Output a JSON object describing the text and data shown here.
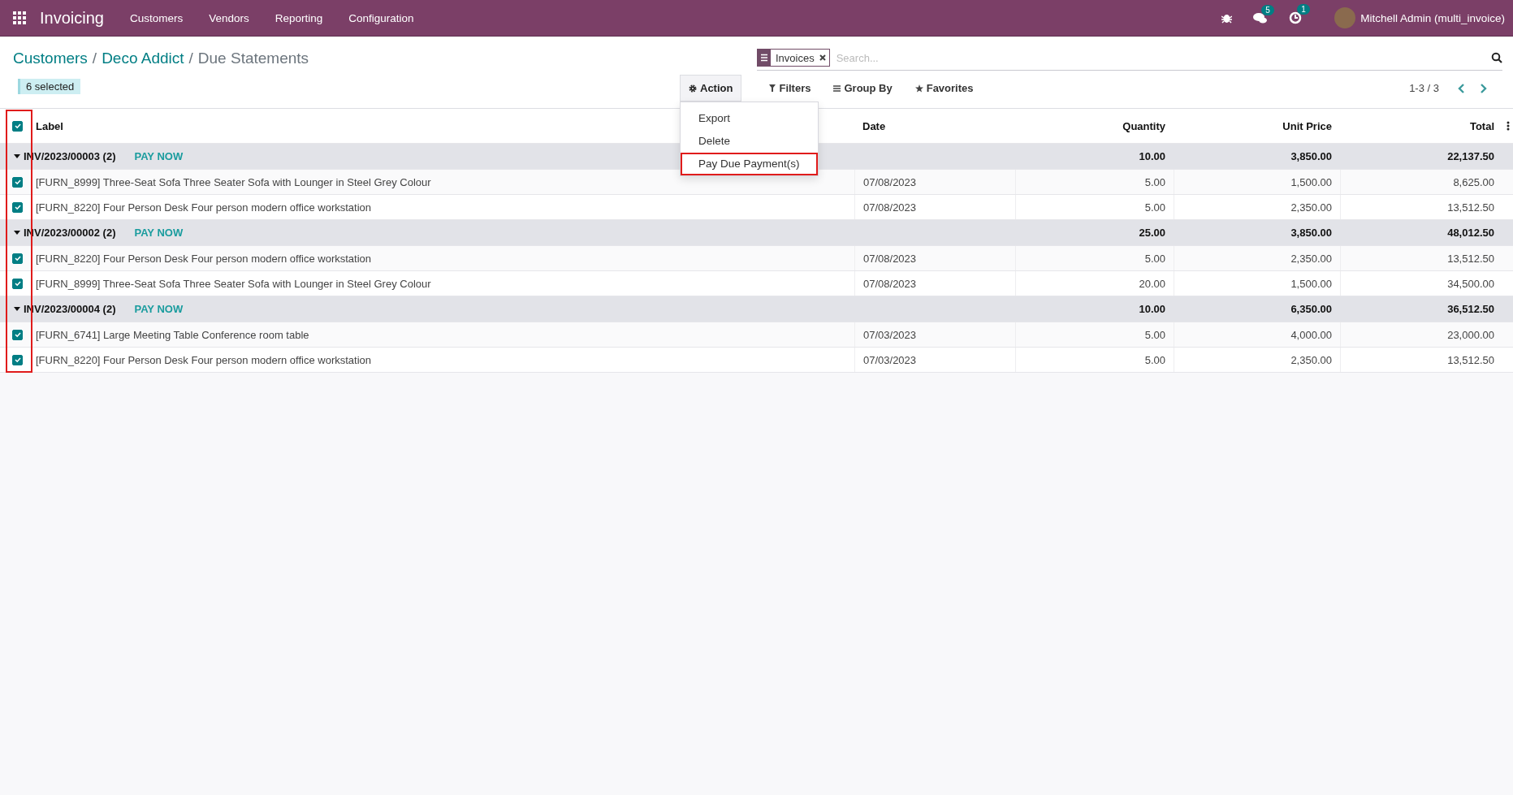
{
  "navbar": {
    "app_name": "Invoicing",
    "menu": [
      "Customers",
      "Vendors",
      "Reporting",
      "Configuration"
    ],
    "messages_count": "5",
    "activities_count": "1",
    "user": "Mitchell Admin (multi_invoice)"
  },
  "breadcrumb": [
    {
      "label": "Customers",
      "kind": "link"
    },
    {
      "prefix": "/",
      "label": "Deco Addict",
      "kind": "link"
    },
    {
      "prefix": "/",
      "label": "Due Statements",
      "kind": "current"
    }
  ],
  "selection_badge": "6 selected",
  "search": {
    "facet": "Invoices",
    "placeholder": "Search..."
  },
  "action": {
    "label": "Action",
    "menu": [
      {
        "label": "Export",
        "annotated": false
      },
      {
        "label": "Delete",
        "annotated": false
      },
      {
        "label": "Pay Due Payment(s)",
        "annotated": true
      }
    ]
  },
  "filters": [
    {
      "kind": "filter",
      "label": "Filters"
    },
    {
      "kind": "group",
      "label": "Group By"
    },
    {
      "kind": "star",
      "label": "Favorites"
    }
  ],
  "pager": "1-3 / 3",
  "table": {
    "all_checked": true,
    "selection_column_annotated": true,
    "columns": [
      "Label",
      "Date",
      "Quantity",
      "Unit Price",
      "Total"
    ],
    "groups": [
      {
        "title": "INV/2023/00003 (2)",
        "expanded": true,
        "action": "PAY NOW",
        "quantity": "10.00",
        "unit_price": "3,850.00",
        "total": "22,137.50",
        "rows": [
          {
            "checked": true,
            "label": "[FURN_8999] Three-Seat Sofa Three Seater Sofa with Lounger in Steel Grey Colour",
            "date": "07/08/2023",
            "quantity": "5.00",
            "unit_price": "1,500.00",
            "total": "8,625.00"
          },
          {
            "checked": true,
            "label": "[FURN_8220] Four Person Desk Four person modern office workstation",
            "date": "07/08/2023",
            "quantity": "5.00",
            "unit_price": "2,350.00",
            "total": "13,512.50"
          }
        ]
      },
      {
        "title": "INV/2023/00002 (2)",
        "expanded": true,
        "action": "PAY NOW",
        "quantity": "25.00",
        "unit_price": "3,850.00",
        "total": "48,012.50",
        "rows": [
          {
            "checked": true,
            "label": "[FURN_8220] Four Person Desk Four person modern office workstation",
            "date": "07/08/2023",
            "quantity": "5.00",
            "unit_price": "2,350.00",
            "total": "13,512.50"
          },
          {
            "checked": true,
            "label": "[FURN_8999] Three-Seat Sofa Three Seater Sofa with Lounger in Steel Grey Colour",
            "date": "07/08/2023",
            "quantity": "20.00",
            "unit_price": "1,500.00",
            "total": "34,500.00"
          }
        ]
      },
      {
        "title": "INV/2023/00004 (2)",
        "expanded": true,
        "action": "PAY NOW",
        "quantity": "10.00",
        "unit_price": "6,350.00",
        "total": "36,512.50",
        "rows": [
          {
            "checked": true,
            "label": "[FURN_6741] Large Meeting Table Conference room table",
            "date": "07/03/2023",
            "quantity": "5.00",
            "unit_price": "4,000.00",
            "total": "23,000.00"
          },
          {
            "checked": true,
            "label": "[FURN_8220] Four Person Desk Four person modern office workstation",
            "date": "07/03/2023",
            "quantity": "5.00",
            "unit_price": "2,350.00",
            "total": "13,512.50"
          }
        ]
      }
    ]
  }
}
